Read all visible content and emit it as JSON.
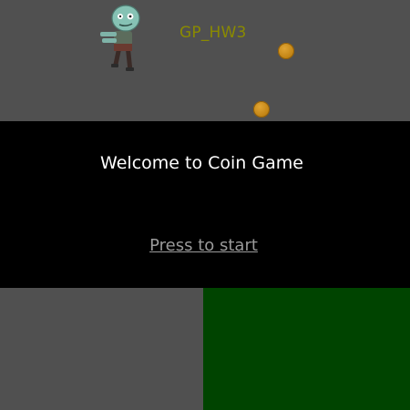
{
  "game": {
    "title": "GP_HW3",
    "icons": {
      "player": "zombie-icon",
      "coin": "coin-icon"
    },
    "colors": {
      "background": "#505050",
      "title": "#8a8a00",
      "coin": "#c48616",
      "overlay": "#000000",
      "green_zone": "#004400"
    }
  },
  "start_screen": {
    "welcome": "Welcome to Coin Game",
    "start_link": "Press to start"
  }
}
